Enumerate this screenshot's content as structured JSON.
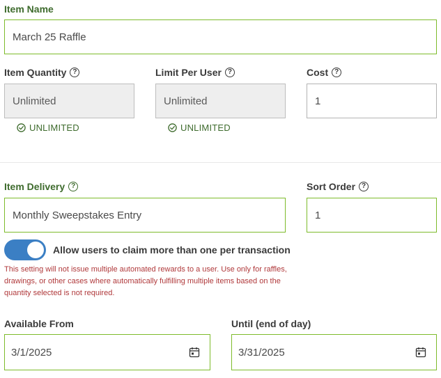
{
  "item_name": {
    "label": "Item Name",
    "value": "March 25 Raffle"
  },
  "item_quantity": {
    "label": "Item Quantity",
    "value": "Unlimited",
    "status": "UNLIMITED"
  },
  "limit_per_user": {
    "label": "Limit Per User",
    "value": "Unlimited",
    "status": "UNLIMITED"
  },
  "cost": {
    "label": "Cost",
    "value": "1"
  },
  "item_delivery": {
    "label": "Item Delivery",
    "value": "Monthly Sweepstakes Entry"
  },
  "sort_order": {
    "label": "Sort Order",
    "value": "1"
  },
  "claim_multiple": {
    "label": "Allow users to claim more than one per transaction",
    "enabled": true,
    "warning": "This setting will not issue multiple automated rewards to a user. Use only for raffles, drawings, or other cases where automatically fulfilling multiple items based on the quantity selected is not required."
  },
  "available_from": {
    "label": "Available From",
    "value": "3/1/2025"
  },
  "until": {
    "label": "Until (end of day)",
    "value": "3/31/2025"
  },
  "help_glyph": "?",
  "colors": {
    "label_green": "#3e6b2d",
    "border_green": "#7dbb2a",
    "toggle_blue": "#3b7fc4",
    "warning_red": "#b0393b"
  },
  "icons": [
    "help-circle-icon",
    "check-circle-icon",
    "calendar-icon"
  ]
}
